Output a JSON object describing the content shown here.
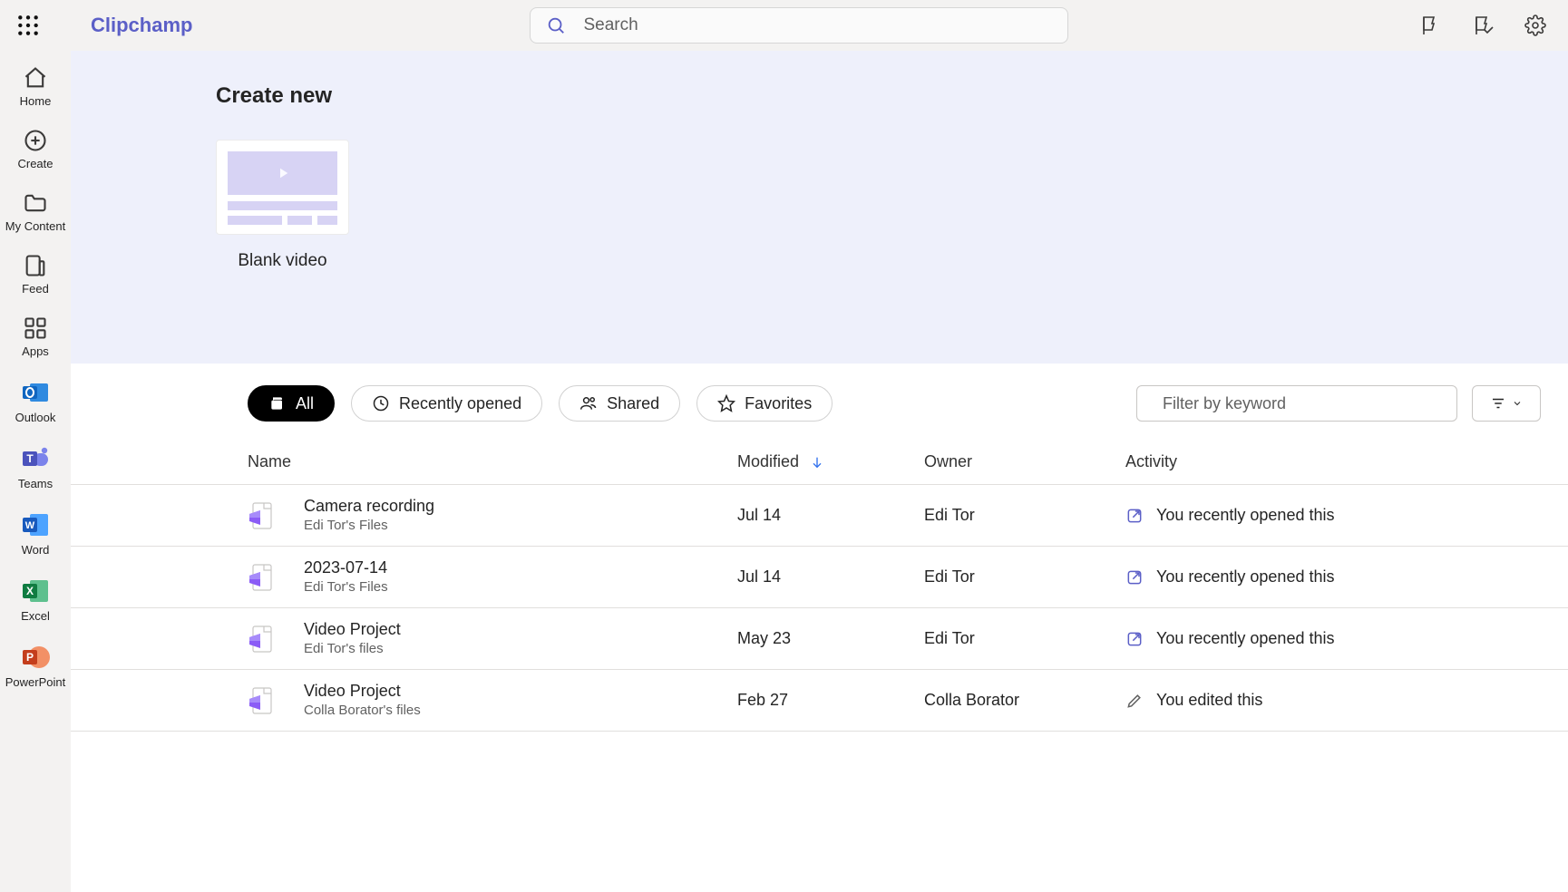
{
  "app_name": "Clipchamp",
  "search": {
    "placeholder": "Search"
  },
  "rail": {
    "items": [
      {
        "id": "home",
        "label": "Home"
      },
      {
        "id": "create",
        "label": "Create"
      },
      {
        "id": "mycontent",
        "label": "My Content"
      },
      {
        "id": "feed",
        "label": "Feed"
      },
      {
        "id": "apps",
        "label": "Apps"
      }
    ],
    "apps": [
      {
        "id": "outlook",
        "label": "Outlook"
      },
      {
        "id": "teams",
        "label": "Teams"
      },
      {
        "id": "word",
        "label": "Word"
      },
      {
        "id": "excel",
        "label": "Excel"
      },
      {
        "id": "ppt",
        "label": "PowerPoint"
      }
    ]
  },
  "hero": {
    "title": "Create new",
    "templates": [
      {
        "label": "Blank video"
      }
    ]
  },
  "filters": {
    "tabs": [
      {
        "id": "all",
        "label": "All",
        "active": true
      },
      {
        "id": "recent",
        "label": "Recently opened",
        "active": false
      },
      {
        "id": "shared",
        "label": "Shared",
        "active": false
      },
      {
        "id": "fav",
        "label": "Favorites",
        "active": false
      }
    ],
    "filter_placeholder": "Filter by keyword"
  },
  "table": {
    "columns": {
      "name": "Name",
      "modified": "Modified",
      "owner": "Owner",
      "activity": "Activity"
    },
    "rows": [
      {
        "name": "Camera recording",
        "sub": "Edi Tor's Files",
        "modified": "Jul 14",
        "owner": "Edi Tor",
        "activity_kind": "opened",
        "activity": "You recently opened this"
      },
      {
        "name": "2023-07-14",
        "sub": "Edi Tor's Files",
        "modified": "Jul 14",
        "owner": "Edi Tor",
        "activity_kind": "opened",
        "activity": "You recently opened this"
      },
      {
        "name": "Video Project",
        "sub": "Edi Tor's files",
        "modified": "May 23",
        "owner": "Edi Tor",
        "activity_kind": "opened",
        "activity": "You recently opened this"
      },
      {
        "name": "Video Project",
        "sub": "Colla Borator's files",
        "modified": "Feb 27",
        "owner": "Colla Borator",
        "activity_kind": "edited",
        "activity": "You edited this"
      }
    ]
  }
}
